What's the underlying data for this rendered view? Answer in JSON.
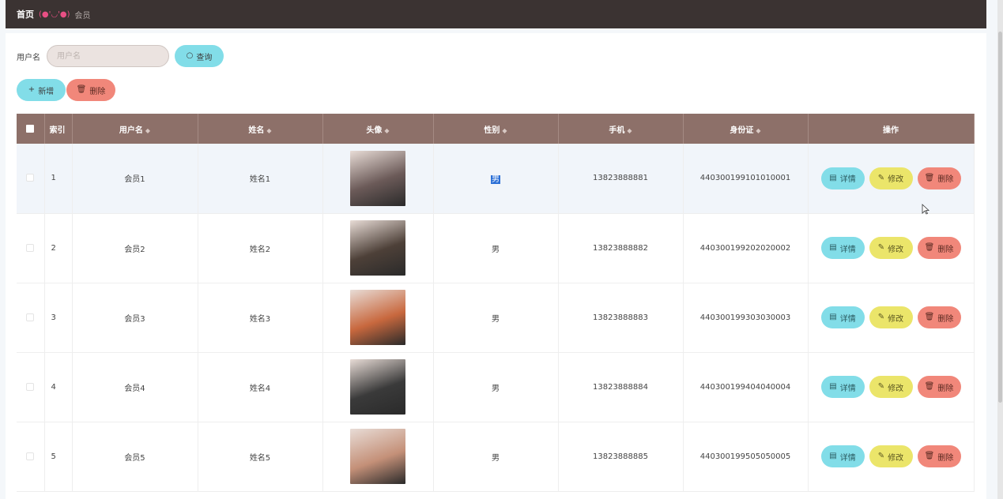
{
  "breadcrumb": {
    "home": "首页",
    "emoticon": "(●'◡'●)",
    "current": "会员"
  },
  "search": {
    "label": "用户名",
    "placeholder": "用户名",
    "value": "",
    "query_label": "查询"
  },
  "actions": {
    "add_label": "新增",
    "delete_label": "删除"
  },
  "table": {
    "headers": [
      "索引",
      "用户名",
      "姓名",
      "头像",
      "性别",
      "手机",
      "身份证",
      "操作"
    ],
    "ops": {
      "detail": "详情",
      "edit": "修改",
      "delete": "删除"
    },
    "rows": [
      {
        "index": "1",
        "username": "会员1",
        "name": "姓名1",
        "gender": "男",
        "phone": "13823888881",
        "id_card": "440300199101010001",
        "avatar_color": "#6b5a58"
      },
      {
        "index": "2",
        "username": "会员2",
        "name": "姓名2",
        "gender": "男",
        "phone": "13823888882",
        "id_card": "440300199202020002",
        "avatar_color": "#4d4038"
      },
      {
        "index": "3",
        "username": "会员3",
        "name": "姓名3",
        "gender": "男",
        "phone": "13823888883",
        "id_card": "440300199303030003",
        "avatar_color": "#c8683e"
      },
      {
        "index": "4",
        "username": "会员4",
        "name": "姓名4",
        "gender": "男",
        "phone": "13823888884",
        "id_card": "440300199404040004",
        "avatar_color": "#3a3a3a"
      },
      {
        "index": "5",
        "username": "会员5",
        "name": "姓名5",
        "gender": "男",
        "phone": "13823888885",
        "id_card": "440300199505050005",
        "avatar_color": "#c49078"
      }
    ]
  },
  "colors": {
    "topbar": "#3b3332",
    "table_header": "#8d7069",
    "btn_cyan": "#82dde8",
    "btn_yellow": "#ebe56a",
    "btn_red": "#f1877a"
  }
}
